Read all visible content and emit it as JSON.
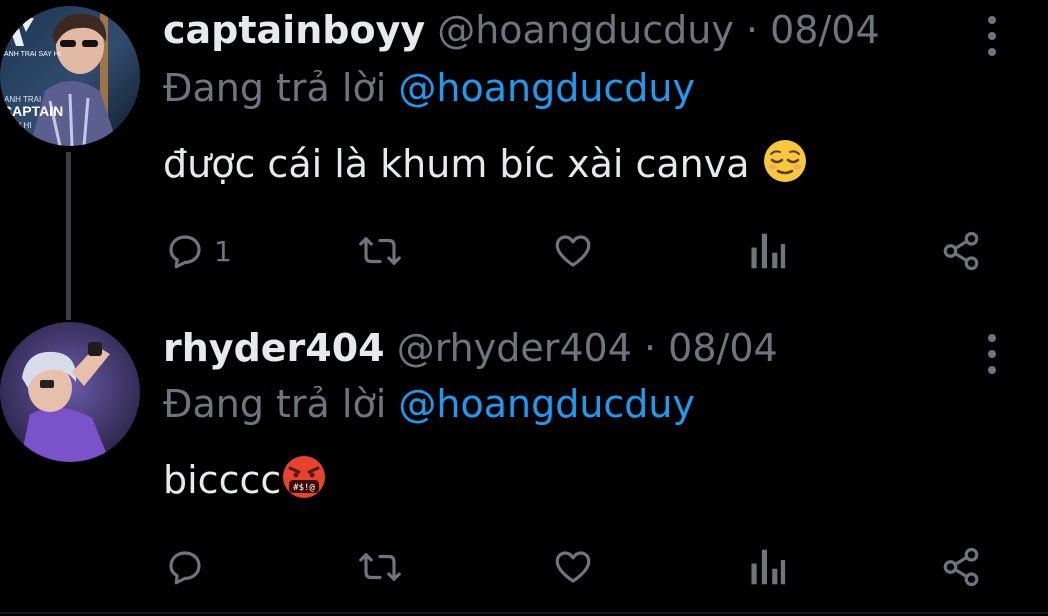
{
  "tweets": [
    {
      "display_name": "captainboyy",
      "handle": "@hoangducduy",
      "separator": "·",
      "date": "08/04",
      "replying_prefix": "Đang trả lời",
      "replying_to": "@hoangducduy",
      "text": "được cái là khum bíc xài canva",
      "emoji": "relieved-face",
      "reply_count": "1",
      "avatar": {
        "label_top": "ANH TRAI SAY HI",
        "label_mid": "ANH TRAI",
        "label_main": "CAPTAIN",
        "label_sub": "SAY HI"
      }
    },
    {
      "display_name": "rhyder404",
      "handle": "@rhyder404",
      "separator": "·",
      "date": "08/04",
      "replying_prefix": "Đang trả lời",
      "replying_to": "@hoangducduy",
      "text": "bicccc",
      "emoji": "face-with-symbols-on-mouth",
      "emoji_text": "#$!@",
      "reply_count": ""
    }
  ],
  "icons": [
    "reply-icon",
    "retweet-icon",
    "like-icon",
    "views-icon",
    "share-icon",
    "more-icon"
  ],
  "colors": {
    "background": "#000000",
    "text": "#e7e9ea",
    "muted": "#6e767d",
    "mention": "#1d9bf0"
  }
}
